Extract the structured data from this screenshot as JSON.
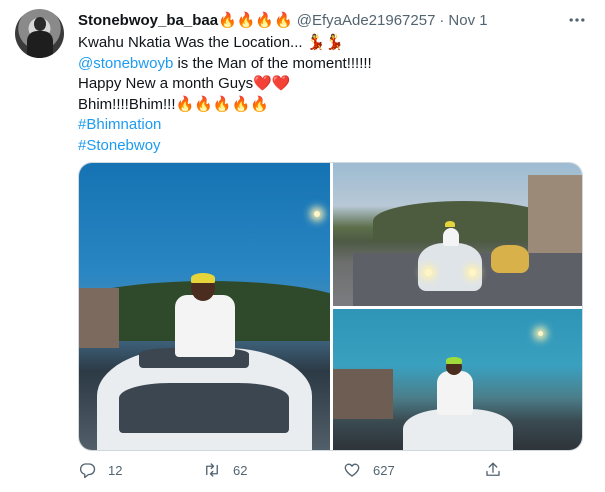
{
  "tweet": {
    "display_name": "Stonebwoy_ba_baa🔥🔥🔥🔥",
    "handle": "@EfyaAde21967257",
    "separator": "·",
    "date": "Nov 1",
    "more_icon": "more-horizontal-icon",
    "lines": [
      "Kwahu Nkatia Was the Location... 💃💃",
      "is the Man of the moment!!!!!!",
      "Happy New a month Guys❤️❤️",
      "Bhim!!!!Bhim!!!🔥🔥🔥🔥🔥"
    ],
    "mention": "@stonebwoyb",
    "hashtags": [
      "#Bhimnation",
      "#Stonebwoy"
    ]
  },
  "media": {
    "images": [
      {
        "icon": "photo-icon"
      },
      {
        "icon": "photo-icon"
      },
      {
        "icon": "photo-icon"
      }
    ]
  },
  "actions": {
    "reply": {
      "icon": "reply-icon",
      "count": "12"
    },
    "retweet": {
      "icon": "retweet-icon",
      "count": "62"
    },
    "like": {
      "icon": "heart-icon",
      "count": "627"
    },
    "share": {
      "icon": "share-icon",
      "count": ""
    }
  },
  "colors": {
    "link": "#1d9bf0",
    "secondary_text": "#536471",
    "primary_text": "#0f1419",
    "border": "#cfd9de"
  }
}
